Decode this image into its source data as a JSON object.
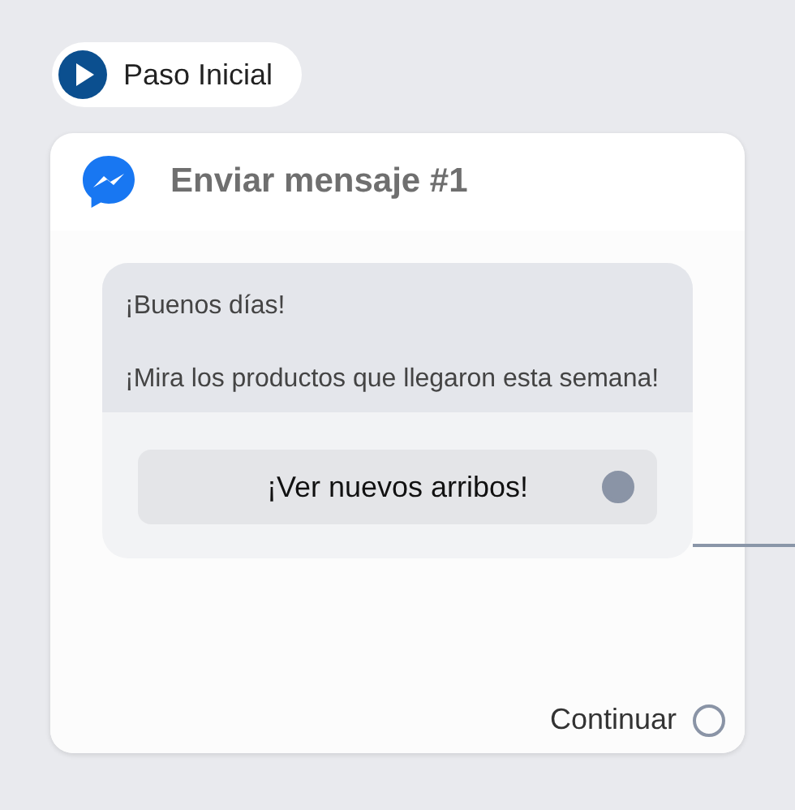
{
  "start_node": {
    "label": "Paso Inicial"
  },
  "card": {
    "title": "Enviar mensaje #1",
    "message": {
      "paragraphs": [
        "¡Buenos días!",
        "¡Mira los productos que llegaron esta semana!"
      ],
      "buttons": [
        {
          "label": "¡Ver nuevos arribos!",
          "connected": true
        }
      ]
    },
    "continue": {
      "label": "Continuar",
      "connected": false
    }
  }
}
